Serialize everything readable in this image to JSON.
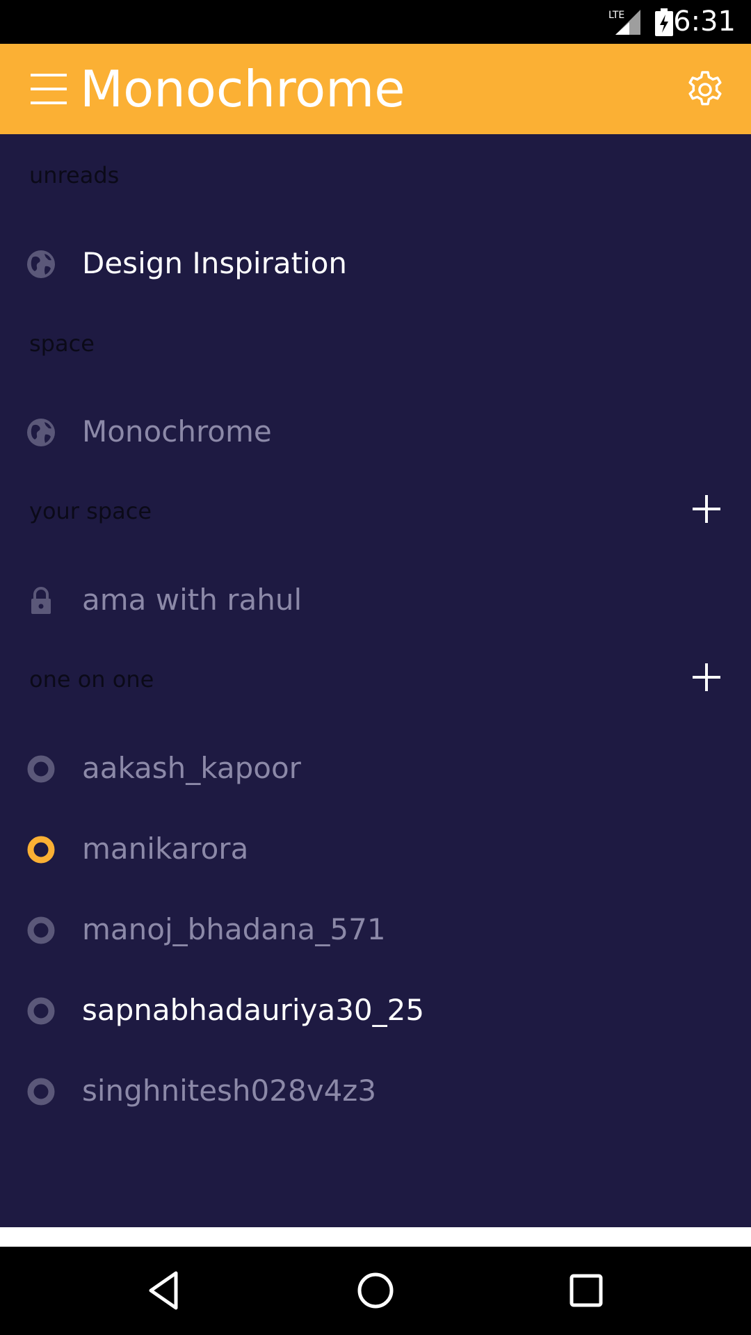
{
  "status": {
    "time": "6:31",
    "network": "LTE"
  },
  "header": {
    "title": "Monochrome",
    "menu_icon": "hamburger-menu-icon",
    "settings_icon": "gear-icon"
  },
  "sections": {
    "unreads": "unreads",
    "space": "space",
    "your_space": "your space",
    "one_on_one": "one on one"
  },
  "items": {
    "unreads": [
      {
        "label": "Design Inspiration",
        "icon": "globe-icon"
      }
    ],
    "space": [
      {
        "label": "Monochrome",
        "icon": "globe-icon"
      }
    ],
    "your_space": [
      {
        "label": "ama with rahul",
        "icon": "lock-icon"
      }
    ],
    "one_on_one": [
      {
        "label": "aakash_kapoor",
        "icon": "ring-icon",
        "status": "offline"
      },
      {
        "label": "manikarora",
        "icon": "ring-icon",
        "status": "online"
      },
      {
        "label": "manoj_bhadana_571",
        "icon": "ring-icon",
        "status": "offline"
      },
      {
        "label": "sapnabhadauriya30_25",
        "icon": "ring-icon",
        "status": "offline"
      },
      {
        "label": "singhnitesh028v4z3",
        "icon": "ring-icon",
        "status": "offline"
      }
    ]
  },
  "colors": {
    "accent": "#fbb034",
    "background": "#1e1a42",
    "muted_text": "#8c89a8",
    "icon_muted": "#5b5879",
    "online": "#fbb034"
  },
  "navigation": {
    "back": "back-icon",
    "home": "home-icon",
    "recents": "recents-icon"
  }
}
